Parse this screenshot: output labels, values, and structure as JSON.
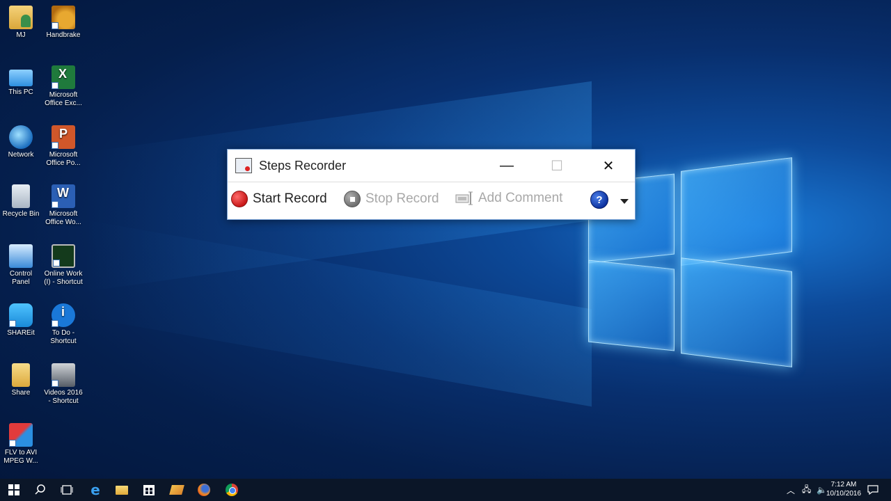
{
  "desktop": {
    "icons": [
      {
        "label": "MJ",
        "icon": "user-folder-icon"
      },
      {
        "label": "Handbrake",
        "icon": "handbrake-icon"
      },
      {
        "label": "This PC",
        "icon": "computer-icon"
      },
      {
        "label": "Microsoft Office Exc...",
        "icon": "excel-icon"
      },
      {
        "label": "Network",
        "icon": "network-icon"
      },
      {
        "label": "Microsoft Office Po...",
        "icon": "powerpoint-icon"
      },
      {
        "label": "Recycle Bin",
        "icon": "recycle-bin-icon"
      },
      {
        "label": "Microsoft Office Wo...",
        "icon": "word-icon"
      },
      {
        "label": "Control Panel",
        "icon": "control-panel-icon"
      },
      {
        "label": "Online Work (I) - Shortcut",
        "icon": "monitor-chart-icon"
      },
      {
        "label": "SHAREit",
        "icon": "shareit-icon"
      },
      {
        "label": "To Do - Shortcut",
        "icon": "info-icon"
      },
      {
        "label": "Share",
        "icon": "folder-icon"
      },
      {
        "label": "Videos 2016 - Shortcut",
        "icon": "camcorder-icon"
      },
      {
        "label": "FLV to AVI MPEG W...",
        "icon": "flv-converter-icon"
      }
    ]
  },
  "window": {
    "title": "Steps Recorder",
    "buttons": {
      "minimize": "—",
      "maximize": "☐",
      "close": "✕"
    },
    "toolbar": {
      "start_record": "Start Record",
      "stop_record": "Stop Record",
      "add_comment": "Add Comment",
      "help": "?"
    }
  },
  "taskbar": {
    "items": [
      "start-icon",
      "search-icon",
      "task-view-icon",
      "edge-icon",
      "file-explorer-icon",
      "store-icon",
      "winamp-icon",
      "firefox-icon",
      "chrome-icon"
    ],
    "tray": [
      "chevron-up-icon",
      "network-icon",
      "volume-icon"
    ],
    "time": "7:12 AM",
    "date": "10/10/2016"
  },
  "colors": {
    "record_red": "#c81818",
    "title_accent": "#7aa3d8",
    "taskbar": "#0b1628"
  }
}
